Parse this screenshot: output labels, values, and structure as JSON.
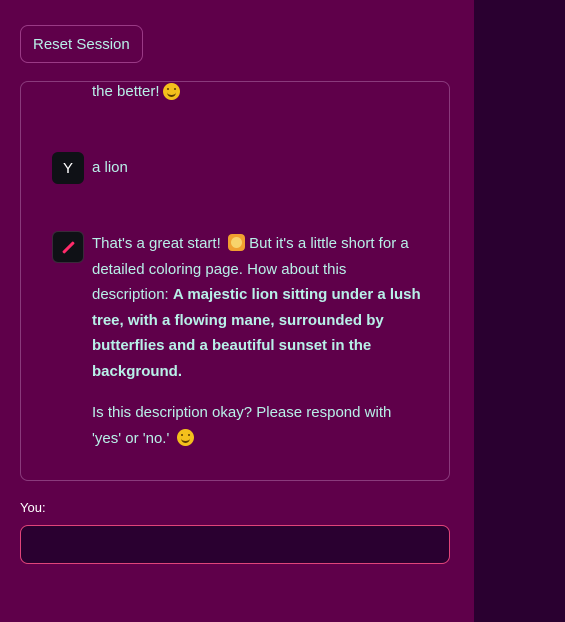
{
  "header": {
    "reset_label": "Reset Session"
  },
  "chat": {
    "fragment_text": "the better!",
    "fragment_emoji": "smiling-face-icon",
    "user_avatar_letter": "Y",
    "user_message": "a lion",
    "bot_avatar_icon": "pencil-icon",
    "bot_message": {
      "intro": "That's a great start!",
      "intro_emoji": "lion-face-icon",
      "cont": " But it's a little short for a detailed coloring page. How about this description: ",
      "bold": "A majestic lion sitting under a lush tree, with a flowing mane, surrounded by butterflies and a beautiful sunset in the background.",
      "question": "Is this description okay? Please respond with 'yes' or 'no.'",
      "question_emoji": "smiling-face-icon"
    }
  },
  "input": {
    "label": "You:",
    "value": "",
    "placeholder": ""
  },
  "colors": {
    "main_bg": "#5f004a",
    "sidebar_bg": "#2a0030",
    "text": "#b8f0e8",
    "input_border": "#e0447a"
  }
}
